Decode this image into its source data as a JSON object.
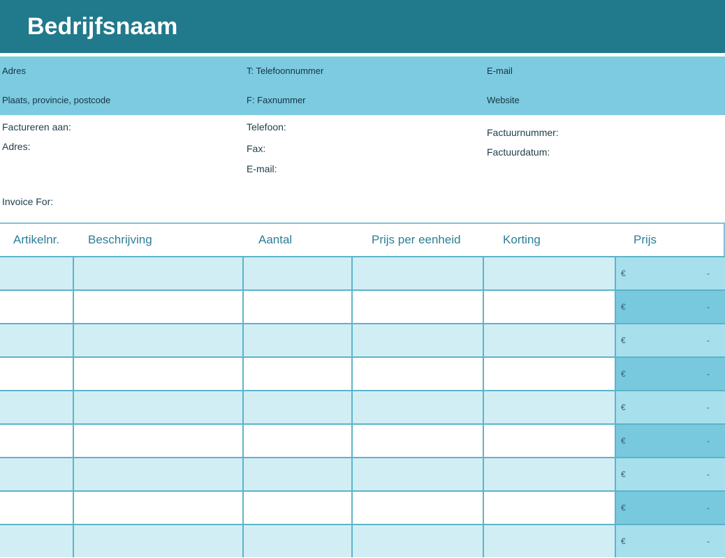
{
  "company": {
    "name": "Bedrijfsnaam"
  },
  "contact": {
    "address": "Adres",
    "city": "Plaats, provincie, postcode",
    "phone": "T: Telefoonnummer",
    "fax": "F: Faxnummer",
    "email": "E-mail",
    "website": "Website"
  },
  "billing": {
    "bill_to": "Factureren aan:",
    "address": "Adres:",
    "invoice_for": "Invoice For:",
    "phone": "Telefoon:",
    "fax": "Fax:",
    "email": "E-mail:",
    "invoice_number": "Factuurnummer:",
    "invoice_date": "Factuurdatum:"
  },
  "table": {
    "headers": {
      "item_no": "Artikelnr.",
      "description": "Beschrijving",
      "quantity": "Aantal",
      "unit_price": "Prijs per eenheid",
      "discount": "Korting",
      "price": "Prijs"
    },
    "currency_symbol": "€",
    "rows": [
      {
        "price": "-"
      },
      {
        "price": "-"
      },
      {
        "price": "-"
      },
      {
        "price": "-"
      },
      {
        "price": "-"
      },
      {
        "price": "-"
      },
      {
        "price": "-"
      },
      {
        "price": "-"
      },
      {
        "price": "-"
      }
    ]
  },
  "colors": {
    "header": "#21798c",
    "info_band": "#7ccbe1",
    "row_light": "#d2eef5",
    "price_light": "#a8dfec",
    "price_dark": "#78c8de",
    "header_text": "#2a7e97"
  }
}
